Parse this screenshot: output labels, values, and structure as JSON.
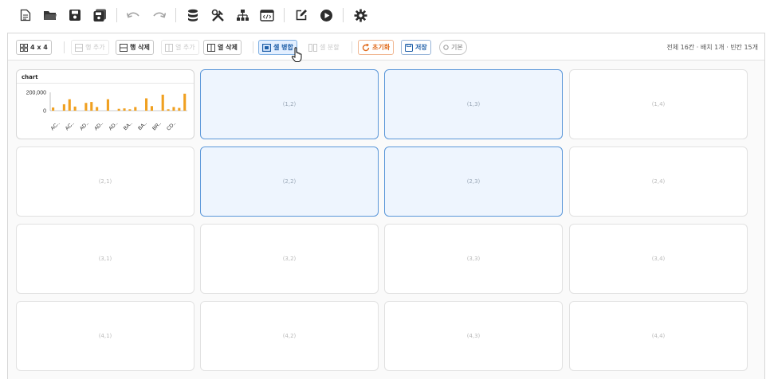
{
  "toolbar": {
    "icons": [
      "new-file-icon",
      "open-folder-icon",
      "save-icon",
      "save-as-icon",
      "undo-icon",
      "redo-icon",
      "database-icon",
      "tools-icon",
      "hierarchy-icon",
      "code-icon",
      "edit-icon",
      "play-icon",
      "settings-icon"
    ]
  },
  "grid_toolbar": {
    "size_label": "4 x 4",
    "add_row": "행 추가",
    "delete_row": "행 삭제",
    "add_col": "열 추가",
    "delete_col": "열 삭제",
    "merge_cells": "셀 병합",
    "split_cells": "셀 분할",
    "reset": "초기화",
    "save": "저장",
    "default": "기본",
    "status": "전체 16칸 · 배치 1개 · 빈칸 15개"
  },
  "cells": [
    {
      "id": "(1,1)",
      "chart": true
    },
    {
      "id": "(1,2)",
      "selected": true
    },
    {
      "id": "(1,3)",
      "selected": true
    },
    {
      "id": "(1,4)"
    },
    {
      "id": "(2,1)"
    },
    {
      "id": "(2,2)",
      "selected": true
    },
    {
      "id": "(2,3)",
      "selected": true
    },
    {
      "id": "(2,4)"
    },
    {
      "id": "(3,1)"
    },
    {
      "id": "(3,2)"
    },
    {
      "id": "(3,3)"
    },
    {
      "id": "(3,4)"
    },
    {
      "id": "(4,1)"
    },
    {
      "id": "(4,2)"
    },
    {
      "id": "(4,3)"
    },
    {
      "id": "(4,4)"
    }
  ],
  "colors": {
    "accent": "#1f5fa8",
    "selected_fill": "#eef5fe",
    "bar": "#f0a020",
    "reset": "#e06a1b"
  },
  "chart_data": {
    "type": "bar",
    "title": "chart",
    "ylim": [
      0,
      200000
    ],
    "yticks": [
      "200,000",
      "0"
    ],
    "grid": false,
    "categories": [
      "AC..",
      "AC..",
      "AD..",
      "AD..",
      "AD..",
      "BA..",
      "BA..",
      "BR..",
      "CD..",
      "",
      "",
      "",
      "",
      "",
      "",
      "",
      "",
      "",
      "",
      "",
      "",
      "",
      "",
      "",
      ""
    ],
    "xtick_labels": [
      "AC..",
      "AC..",
      "AD..",
      "AD..",
      "AD..",
      "BA..",
      "BA..",
      "BR..",
      "CD.."
    ],
    "values": [
      35000,
      0,
      70000,
      125000,
      45000,
      0,
      85000,
      95000,
      40000,
      0,
      125000,
      0,
      20000,
      25000,
      15000,
      40000,
      0,
      135000,
      50000,
      0,
      175000,
      15000,
      40000,
      30000,
      185000
    ]
  }
}
